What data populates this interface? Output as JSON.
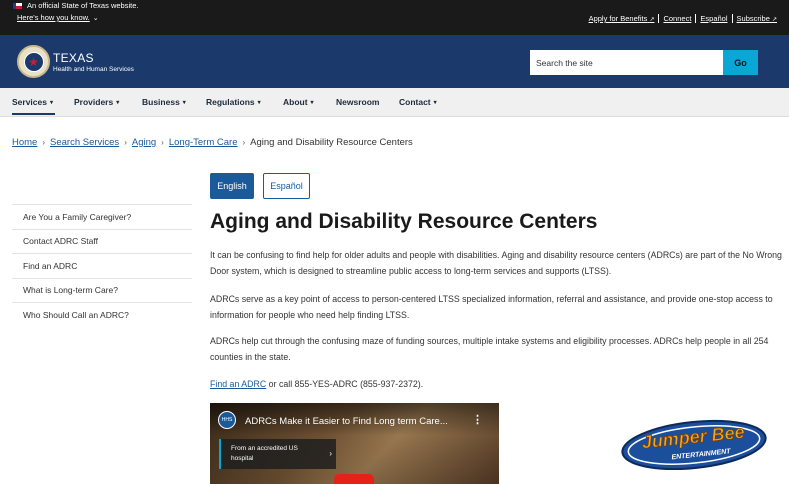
{
  "banner": {
    "official_text": "An official State of Texas website.",
    "how_know": "Here's how you know.",
    "links": [
      "Apply for Benefits",
      "Connect",
      "Español",
      "Subscribe"
    ]
  },
  "header": {
    "brand_title": "TEXAS",
    "brand_subtitle": "Health and Human Services",
    "search_placeholder": "Search the site",
    "go_label": "Go"
  },
  "nav": {
    "items": [
      "Services",
      "Providers",
      "Business",
      "Regulations",
      "About",
      "Newsroom",
      "Contact"
    ]
  },
  "breadcrumb": {
    "items": [
      "Home",
      "Search Services",
      "Aging",
      "Long-Term Care"
    ],
    "current": "Aging and Disability Resource Centers"
  },
  "sidebar": {
    "items": [
      "Are You a Family Caregiver?",
      "Contact ADRC Staff",
      "Find an ADRC",
      "What is Long-term Care?",
      "Who Should Call an ADRC?"
    ]
  },
  "language": {
    "english": "English",
    "spanish": "Español"
  },
  "main": {
    "title": "Aging and Disability Resource Centers",
    "p1": "It can be confusing to find help for older adults and people with disabilities. Aging and disability resource centers (ADRCs) are part of the No Wrong Door system, which is designed to streamline public access to long-term services and supports (LTSS).",
    "p2": "ADRCs serve as a key point of access to person-centered LTSS specialized information, referral and assistance, and provide one-stop access to information for people who need help finding LTSS.",
    "p3": "ADRCs help cut through the confusing maze of funding sources, multiple intake systems and eligibility processes. ADRCs help people in all 254 counties in the state.",
    "p4_link": "Find an ADRC",
    "p4_rest": " or call 855-YES-ADRC (855-937-2372)."
  },
  "video": {
    "title": "ADRCs Make it Easier to Find Long term Care...",
    "logo_text": "HHS",
    "badge_line1": "From an accredited US",
    "badge_line2": "hospital"
  },
  "jumper_bee": {
    "line1": "Jumper Bee",
    "line2": "ENTERTAINMENT"
  },
  "colors": {
    "header_bg": "#1b3a6b",
    "go_button": "#0aa6d6",
    "link": "#1b5a9a",
    "top_banner": "#1a1a1a"
  }
}
